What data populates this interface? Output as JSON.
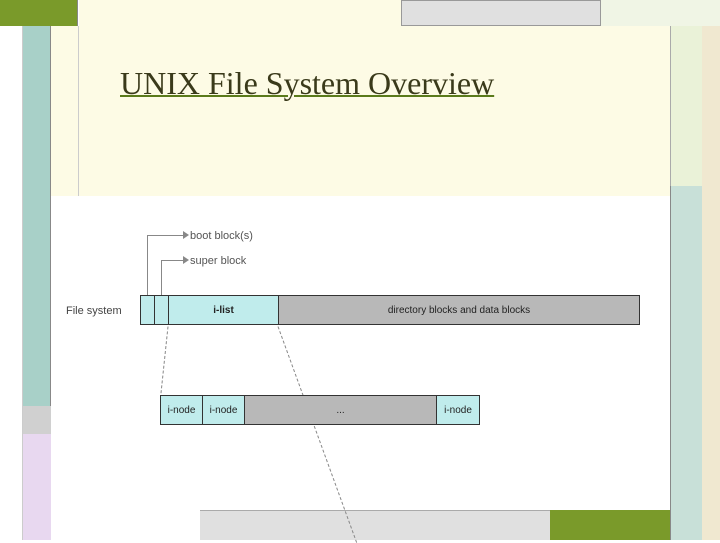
{
  "title": "UNIX File System Overview",
  "fsLabel": "File system",
  "arrows": {
    "boot": "boot block(s)",
    "super": "super block"
  },
  "fsSegments": {
    "ilist": "i-list",
    "data": "directory blocks and data blocks"
  },
  "inodeSegments": {
    "inode": "i-node",
    "ellipsis": "..."
  },
  "colors": {
    "olive": "#7a9a2a",
    "beige": "#fdfbe5",
    "cyan": "#c0ecec",
    "gray": "#b8b8b8"
  }
}
